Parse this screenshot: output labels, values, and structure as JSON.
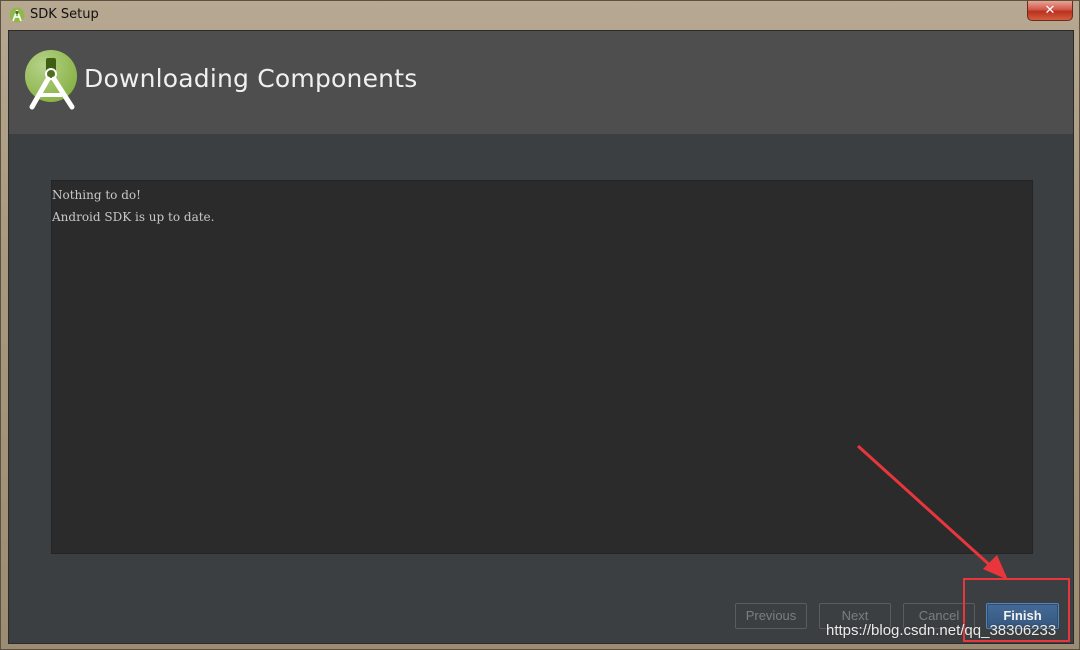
{
  "window": {
    "title": "SDK Setup",
    "close_glyph": "✕"
  },
  "header": {
    "title": "Downloading Components",
    "logo_icon": "android-studio-icon"
  },
  "console": {
    "lines": [
      "Nothing to do!",
      "Android SDK is up to date."
    ]
  },
  "buttons": {
    "previous": "Previous",
    "next": "Next",
    "cancel": "Cancel",
    "finish": "Finish"
  },
  "watermark": "https://blog.csdn.net/qq_38306233",
  "colors": {
    "accent": "#e8363c",
    "primary_button": "#365880",
    "background": "#3c3f41"
  }
}
